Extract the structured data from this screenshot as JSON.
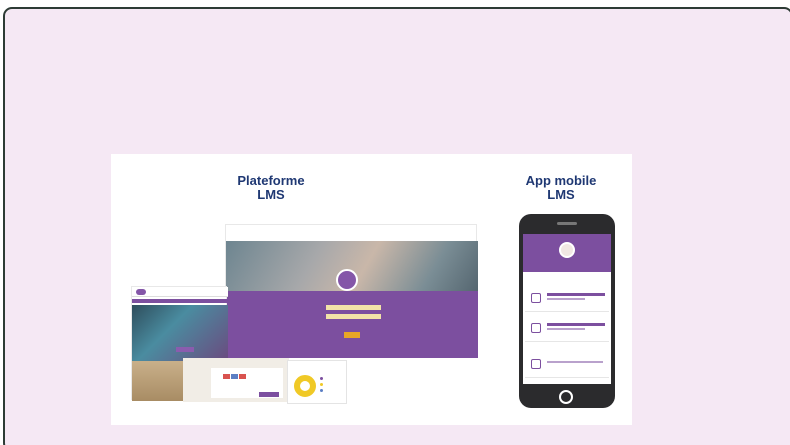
{
  "slide": {
    "lms_title_line1": "Plateforme",
    "lms_title_line2": "LMS",
    "app_title_line1": "App mobile",
    "app_title_line2": "LMS"
  },
  "colors": {
    "background": "#f5e8f4",
    "title": "#1f3873",
    "brand_purple": "#7c4f9f",
    "accent_yellow": "#f0c926",
    "button_orange": "#e8a626"
  },
  "icons": [
    "avatar-icon",
    "home-button-icon",
    "donut-chart-icon"
  ]
}
